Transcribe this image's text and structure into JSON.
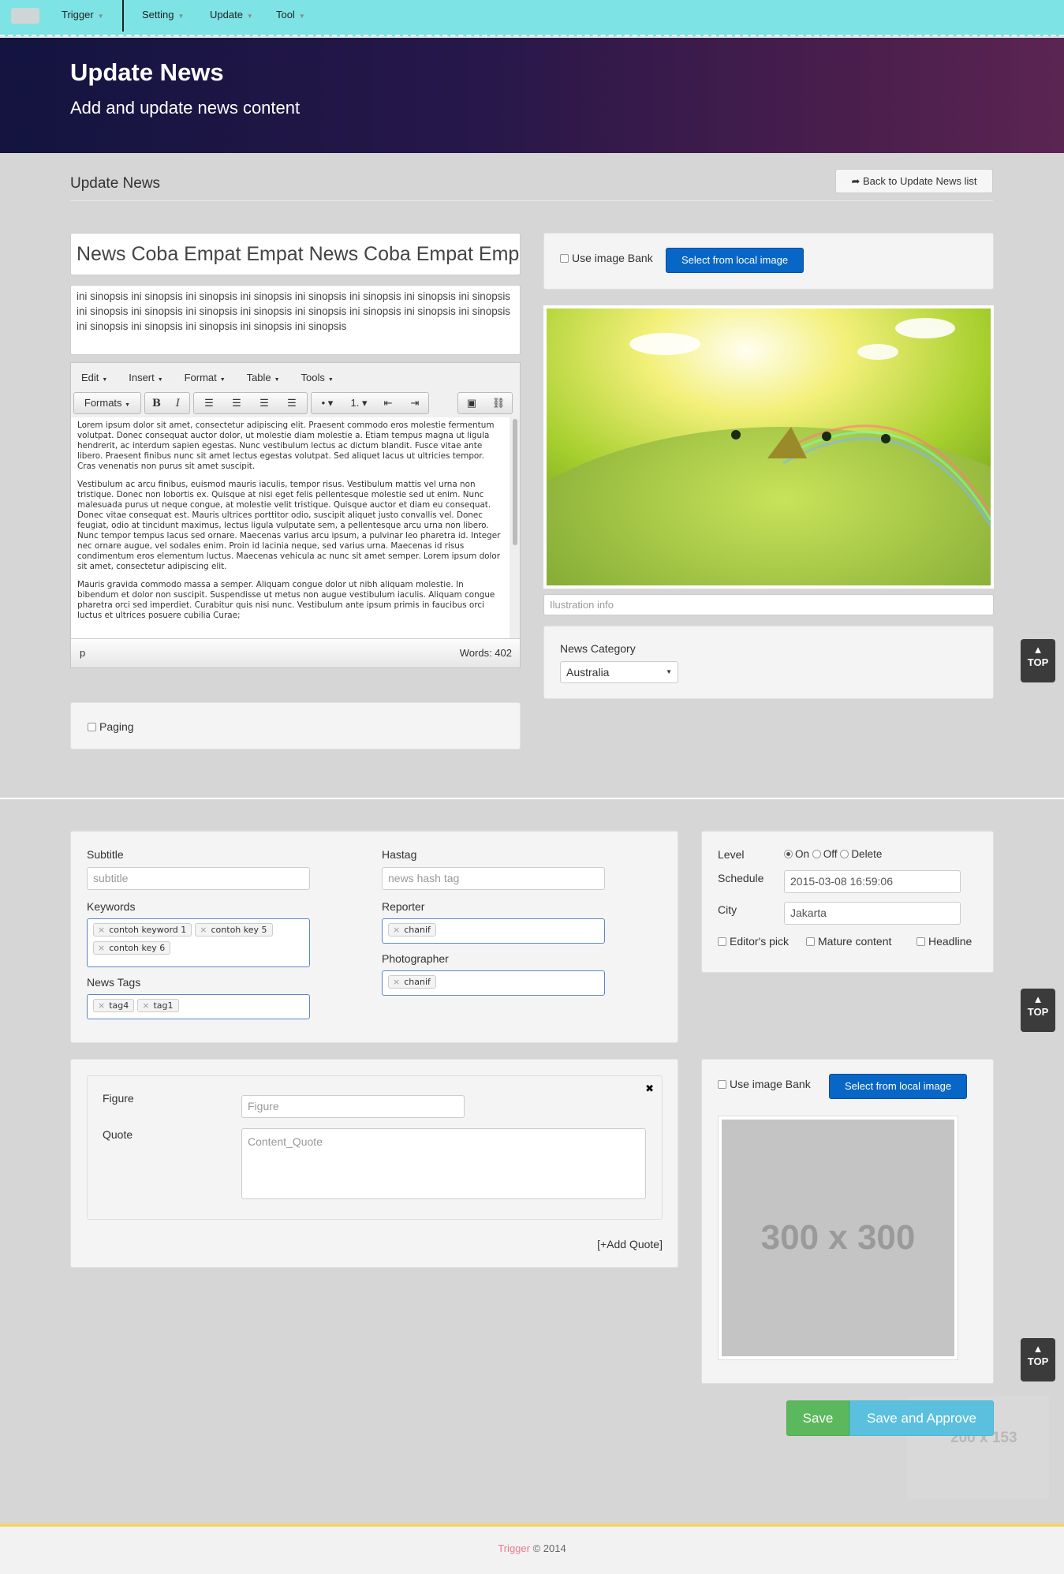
{
  "nav": {
    "items": [
      "Trigger",
      "Setting",
      "Update",
      "Tool"
    ]
  },
  "hero": {
    "title": "Update News",
    "subtitle": "Add and update news content"
  },
  "page": {
    "title": "Update News",
    "back_label": "Back to Update News list"
  },
  "article": {
    "headline": "News Coba Empat Empat News Coba Empat Empat",
    "synopsis": "ini sinopsis ini sinopsis ini sinopsis ini sinopsis ini sinopsis ini sinopsis ini sinopsis ini sinopsis ini sinopsis ini sinopsis ini sinopsis ini sinopsis ini sinopsis ini sinopsis ini sinopsis ini sinopsis ini sinopsis ini sinopsis ini sinopsis ini sinopsis ini sinopsis"
  },
  "editor": {
    "menu": [
      "Edit",
      "Insert",
      "Format",
      "Table",
      "Tools"
    ],
    "formats_label": "Formats",
    "paragraphs": [
      "Lorem ipsum dolor sit amet, consectetur adipiscing elit. Praesent commodo eros molestie fermentum volutpat. Donec consequat auctor dolor, ut molestie diam molestie a. Etiam tempus magna ut ligula hendrerit, ac interdum sapien egestas. Nunc vestibulum lectus ac dictum blandit. Fusce vitae ante libero. Praesent finibus nunc sit amet lectus egestas volutpat. Sed aliquet lacus ut ultricies tempor. Cras venenatis non purus sit amet suscipit.",
      "Vestibulum ac arcu finibus, euismod mauris iaculis, tempor risus. Vestibulum mattis vel urna non tristique. Donec non lobortis ex. Quisque at nisi eget felis pellentesque molestie sed ut enim. Nunc malesuada purus ut neque congue, at molestie velit tristique. Quisque auctor et diam eu consequat. Donec vitae consequat est. Mauris ultrices porttitor odio, suscipit aliquet justo convallis vel. Donec feugiat, odio at tincidunt maximus, lectus ligula vulputate sem, a pellentesque arcu urna non libero. Nunc tempor tempus lacus sed ornare. Maecenas varius arcu ipsum, a pulvinar leo pharetra id. Integer nec ornare augue, vel sodales enim. Proin id lacinia neque, sed varius urna. Maecenas id risus condimentum eros elementum luctus. Maecenas vehicula ac nunc sit amet semper. Lorem ipsum dolor sit amet, consectetur adipiscing elit.",
      "Mauris gravida commodo massa a semper. Aliquam congue dolor ut nibh aliquam molestie. In bibendum et dolor non suscipit. Suspendisse ut metus non augue vestibulum iaculis. Aliquam congue pharetra orci sed imperdiet. Curabitur quis nisi nunc. Vestibulum ante ipsum primis in faucibus orci luctus et ultrices posuere cubilia Curae;"
    ],
    "path": "p",
    "word_count": "Words: 402"
  },
  "paging_label": "Paging",
  "image_panel": {
    "use_bank_label": "Use image Bank",
    "select_label": "Select from local image",
    "illustration_placeholder": "Ilustration info"
  },
  "category": {
    "label": "News Category",
    "value": "Australia"
  },
  "top_label": "TOP",
  "meta": {
    "subtitle_label": "Subtitle",
    "subtitle_placeholder": "subtitle",
    "hashtag_label": "Hastag",
    "hashtag_placeholder": "news hash tag",
    "keywords_label": "Keywords",
    "keywords": [
      "contoh keyword 1",
      "contoh key 5",
      "contoh key 6"
    ],
    "reporter_label": "Reporter",
    "reporters": [
      "chanif"
    ],
    "photographer_label": "Photographer",
    "photographers": [
      "chanif"
    ],
    "tags_label": "News Tags",
    "tags": [
      "tag4",
      "tag1"
    ]
  },
  "level": {
    "label": "Level",
    "on": "On",
    "off": "Off",
    "delete": "Delete",
    "schedule_label": "Schedule",
    "schedule_value": "2015-03-08 16:59:06",
    "city_label": "City",
    "city_value": "Jakarta",
    "editors_pick": "Editor's pick",
    "mature": "Mature content",
    "headline": "Headline"
  },
  "quote": {
    "figure_label": "Figure",
    "figure_placeholder": "Figure",
    "quote_label": "Quote",
    "quote_placeholder": "Content_Quote",
    "add_label": "[+Add Quote]",
    "close": "✖"
  },
  "placeholder_image": {
    "text": "300 x 300",
    "ghost_text": "200 x 153"
  },
  "actions": {
    "save": "Save",
    "save_approve": "Save and Approve"
  },
  "footer": {
    "brand": "Trigger",
    "copy": "© 2014"
  },
  "colors": {
    "accent": "#0866c6",
    "nav": "#7ee3e4",
    "save": "#5cb85c",
    "approve": "#5bc0de"
  }
}
